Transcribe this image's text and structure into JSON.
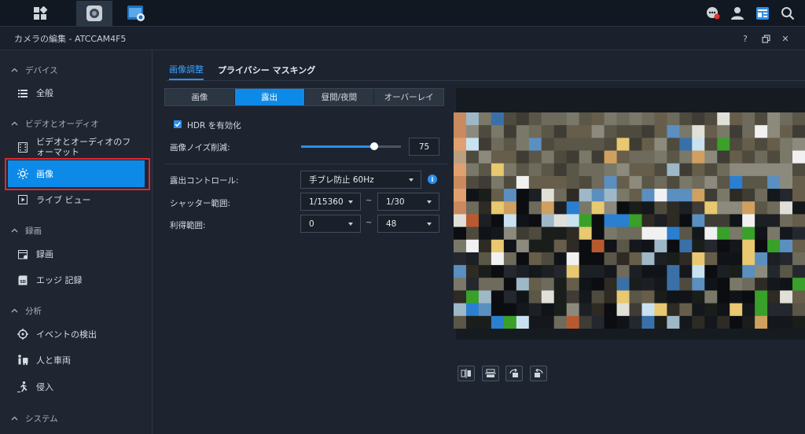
{
  "app": {
    "window_title": "カメラの編集 - ATCCAM4F5"
  },
  "sidebar": {
    "sections": [
      {
        "label": "デバイス"
      },
      {
        "label": "ビデオとオーディオ"
      },
      {
        "label": "録画"
      },
      {
        "label": "分析"
      },
      {
        "label": "システム"
      }
    ],
    "items": [
      {
        "label": "全般"
      },
      {
        "label": "ビデオとオーディオのフォーマット"
      },
      {
        "label": "画像"
      },
      {
        "label": "ライブ ビュー"
      },
      {
        "label": "録画"
      },
      {
        "label": "エッジ 記録"
      },
      {
        "label": "イベントの検出"
      },
      {
        "label": "人と車両"
      },
      {
        "label": "侵入"
      }
    ]
  },
  "main": {
    "tabs": [
      {
        "label": "画像調整"
      },
      {
        "label": "プライバシー マスキング"
      }
    ],
    "segments": [
      {
        "label": "画像"
      },
      {
        "label": "露出"
      },
      {
        "label": "昼間/夜間"
      },
      {
        "label": "オーバーレイ"
      }
    ],
    "hdr_label": "HDR を有効化",
    "noise_label": "画像ノイズ削減:",
    "noise_value": "75",
    "noise_level_fraction": 0.75,
    "exposure_label": "露出コントロール:",
    "exposure_value": "手ブレ防止 60Hz",
    "shutter_label": "シャッター範囲:",
    "shutter_min": "1/15360",
    "shutter_max": "1/30",
    "gain_label": "利得範囲:",
    "gain_min": "0",
    "gain_max": "48",
    "tilde": "~",
    "info_glyph": "i"
  },
  "titlebar": {
    "help": "?",
    "close": "✕"
  },
  "colors": {
    "accent": "#0d8ae8",
    "highlight_box": "#e3262e"
  }
}
